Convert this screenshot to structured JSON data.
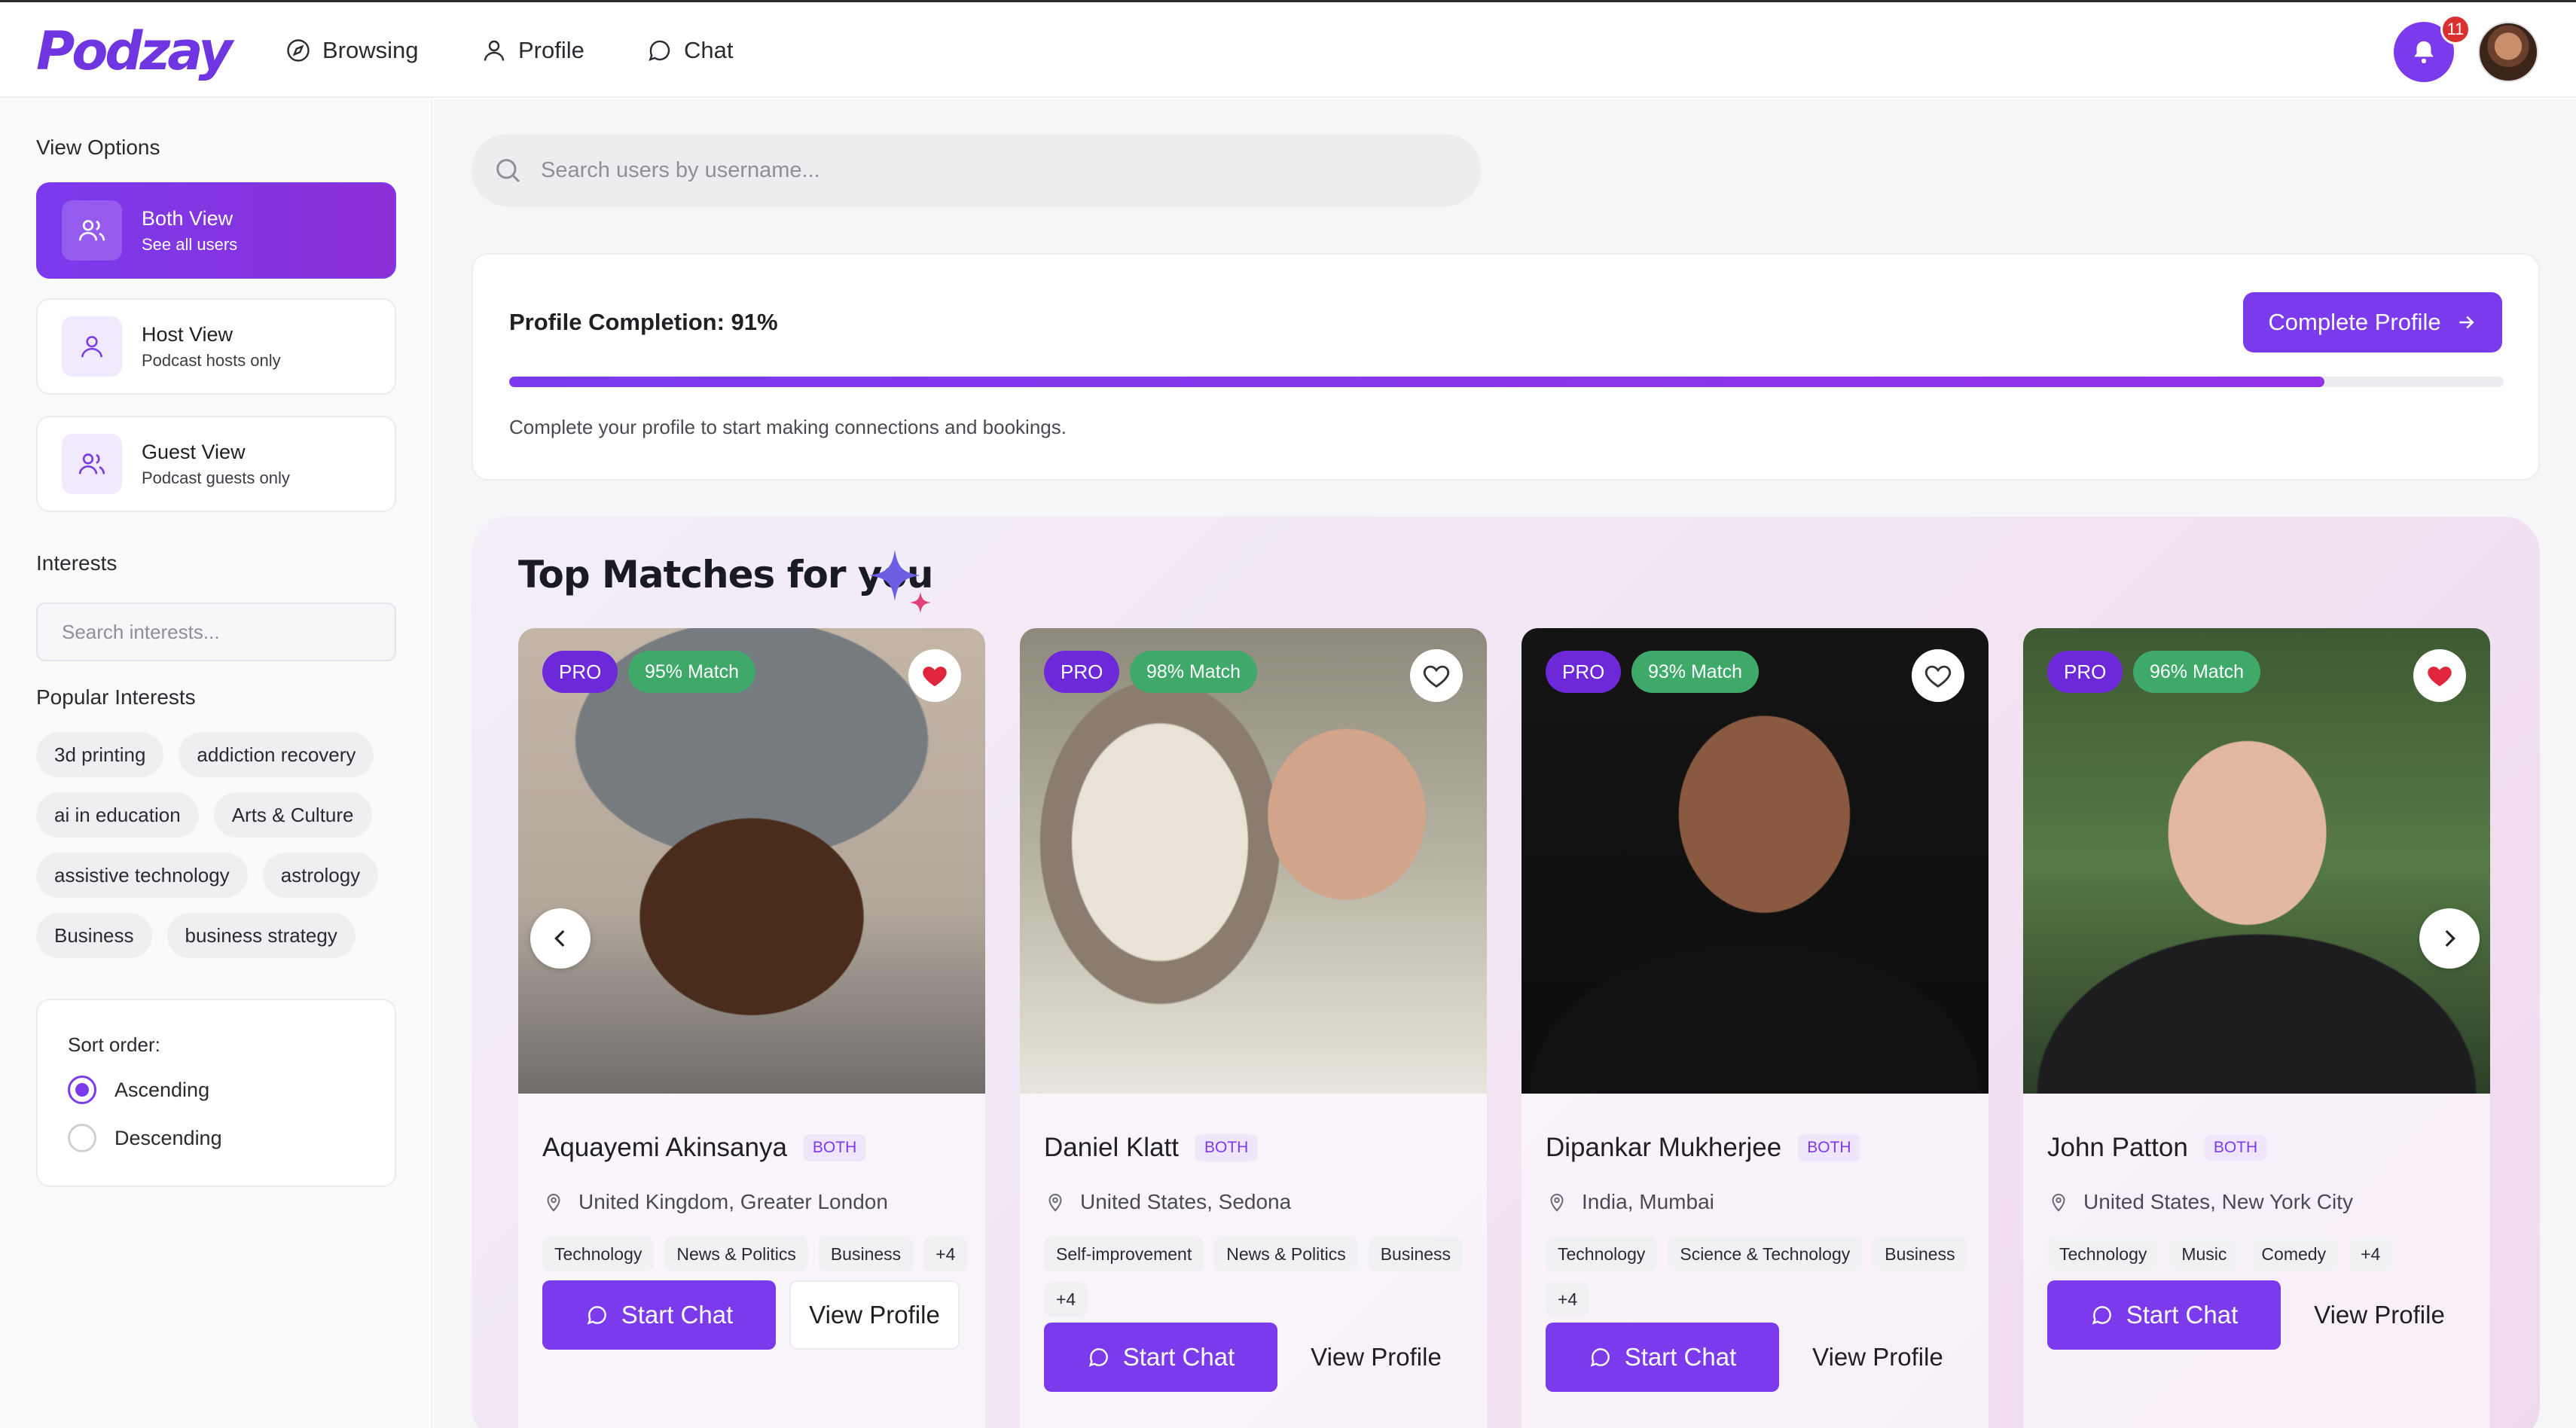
{
  "app": {
    "logo": "Podzay",
    "notification_count": "11"
  },
  "nav": [
    {
      "label": "Browsing",
      "icon": "compass-icon"
    },
    {
      "label": "Profile",
      "icon": "user-icon"
    },
    {
      "label": "Chat",
      "icon": "chat-bubble-icon"
    }
  ],
  "sidebar": {
    "view_options_heading": "View Options",
    "view_options": [
      {
        "title": "Both View",
        "subtitle": "See all users",
        "active": true,
        "icon": "users-icon"
      },
      {
        "title": "Host View",
        "subtitle": "Podcast hosts only",
        "active": false,
        "icon": "user-icon"
      },
      {
        "title": "Guest View",
        "subtitle": "Podcast guests only",
        "active": false,
        "icon": "users-icon"
      }
    ],
    "interests_heading": "Interests",
    "interest_search_placeholder": "Search interests...",
    "popular_heading": "Popular Interests",
    "popular_interests": [
      "3d printing",
      "addiction recovery",
      "ai in education",
      "Arts & Culture",
      "assistive technology",
      "astrology",
      "Business",
      "business strategy"
    ],
    "sort": {
      "label": "Sort order:",
      "options": [
        "Ascending",
        "Descending"
      ],
      "selected": "Ascending"
    }
  },
  "search": {
    "placeholder": "Search users by username..."
  },
  "completion": {
    "title": "Profile Completion: 91%",
    "percent": 91,
    "button": "Complete Profile",
    "note": "Complete your profile to start making connections and bookings."
  },
  "matches": {
    "title": "Top Matches for you",
    "cards": [
      {
        "name": "Aquayemi Akinsanya",
        "role": "BOTH",
        "pro": "PRO",
        "match": "95% Match",
        "location": "United Kingdom, Greater London",
        "tags": [
          "Technology",
          "News & Politics",
          "Business",
          "+4"
        ],
        "favorited": true,
        "chat_label": "Start Chat",
        "view_label": "View Profile"
      },
      {
        "name": "Daniel Klatt",
        "role": "BOTH",
        "pro": "PRO",
        "match": "98% Match",
        "location": "United States, Sedona",
        "tags": [
          "Self-improvement",
          "News & Politics",
          "Business",
          "+4"
        ],
        "favorited": false,
        "chat_label": "Start Chat",
        "view_label": "View Profile"
      },
      {
        "name": "Dipankar Mukherjee",
        "role": "BOTH",
        "pro": "PRO",
        "match": "93% Match",
        "location": "India, Mumbai",
        "tags": [
          "Technology",
          "Science & Technology",
          "Business",
          "+4"
        ],
        "favorited": false,
        "chat_label": "Start Chat",
        "view_label": "View Profile"
      },
      {
        "name": "John Patton",
        "role": "BOTH",
        "pro": "PRO",
        "match": "96% Match",
        "location": "United States, New York City",
        "tags": [
          "Technology",
          "Music",
          "Comedy",
          "+4"
        ],
        "favorited": true,
        "chat_label": "Start Chat",
        "view_label": "View Profile"
      }
    ]
  },
  "colors": {
    "accent": "#7c3aed",
    "match_green": "#3fa96a",
    "heart_red": "#e0263a"
  }
}
